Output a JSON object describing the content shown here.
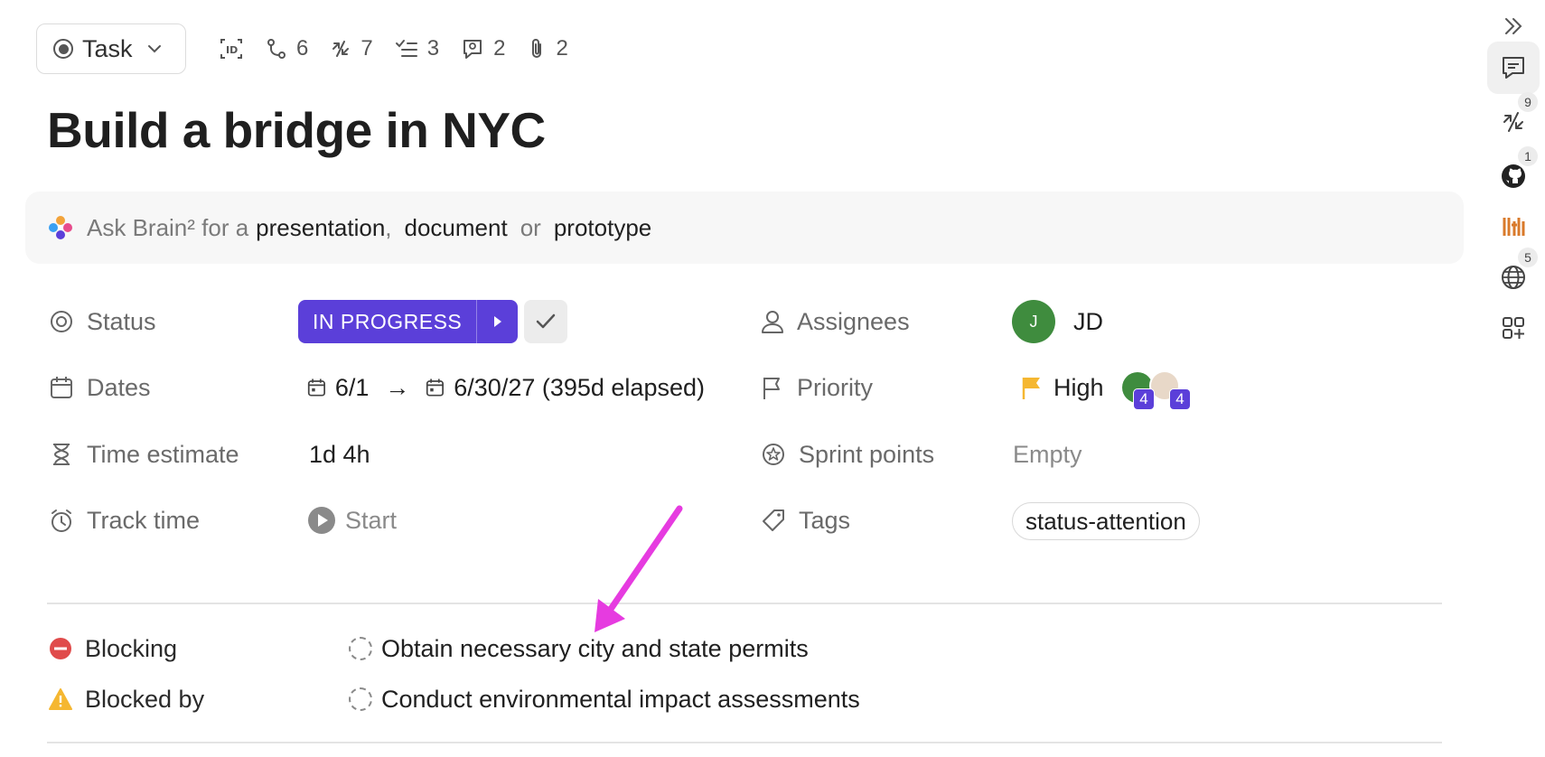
{
  "toolbar": {
    "task_type": "Task",
    "meta": [
      {
        "icon": "id-icon",
        "count": ""
      },
      {
        "icon": "relationship-icon",
        "count": "6"
      },
      {
        "icon": "dependency-icon",
        "count": "7"
      },
      {
        "icon": "checklist-icon",
        "count": "3"
      },
      {
        "icon": "comment-icon",
        "count": "2"
      },
      {
        "icon": "attachment-icon",
        "count": "2"
      }
    ]
  },
  "task": {
    "title": "Build a bridge in NYC"
  },
  "ask_bar": {
    "prefix": "Ask Brain² for a",
    "option1": "presentation",
    "sep1": ",",
    "option2": "document",
    "sep2": "or",
    "option3": "prototype"
  },
  "fields": {
    "status": {
      "label": "Status",
      "value": "IN PROGRESS",
      "color": "#5b3fd9"
    },
    "dates": {
      "label": "Dates",
      "start": "6/1",
      "end": "6/30/27 (395d elapsed)"
    },
    "time_estimate": {
      "label": "Time estimate",
      "value": "1d 4h"
    },
    "track_time": {
      "label": "Track time",
      "value": "Start"
    },
    "assignees": {
      "label": "Assignees",
      "initials": "J",
      "name": "JD",
      "avatar_color": "#3f8c3e"
    },
    "priority": {
      "label": "Priority",
      "value": "High",
      "flag_color": "#f5b731",
      "watcher_badge_1": "4",
      "watcher_badge_2": "4"
    },
    "sprint_points": {
      "label": "Sprint points",
      "value": "Empty"
    },
    "tags": {
      "label": "Tags",
      "value": "status-attention"
    }
  },
  "dependencies": {
    "blocking": {
      "label": "Blocking",
      "task": "Obtain necessary city and state permits"
    },
    "blocked_by": {
      "label": "Blocked by",
      "task": "Conduct environmental impact assessments"
    }
  },
  "rail": {
    "items": [
      {
        "icon": "collapse-icon",
        "badge": ""
      },
      {
        "icon": "activity-icon",
        "badge": ""
      },
      {
        "icon": "dependency-icon",
        "badge": "9"
      },
      {
        "icon": "github-icon",
        "badge": "1"
      },
      {
        "icon": "integration-icon",
        "badge": ""
      },
      {
        "icon": "globe-icon",
        "badge": "5"
      },
      {
        "icon": "add-apps-icon",
        "badge": ""
      }
    ]
  },
  "annotation": {
    "arrow_color": "#e63be0"
  }
}
